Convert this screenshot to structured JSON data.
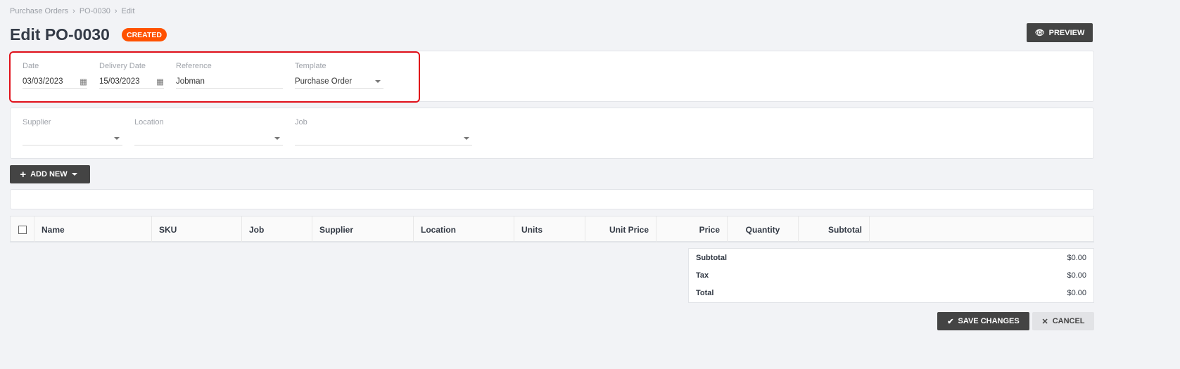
{
  "breadcrumb": [
    "Purchase Orders",
    "PO-0030",
    "Edit"
  ],
  "title": "Edit PO-0030",
  "status": "CREATED",
  "preview_label": "PREVIEW",
  "header_fields": {
    "date_label": "Date",
    "date": "03/03/2023",
    "delivery_label": "Delivery Date",
    "delivery": "15/03/2023",
    "reference_label": "Reference",
    "reference": "Jobman",
    "template_label": "Template",
    "template": "Purchase Order"
  },
  "assign_fields": {
    "supplier_label": "Supplier",
    "location_label": "Location",
    "job_label": "Job"
  },
  "add_new_label": "ADD NEW",
  "columns": [
    "Name",
    "SKU",
    "Job",
    "Supplier",
    "Location",
    "Units",
    "Unit Price",
    "Price",
    "Quantity",
    "Subtotal"
  ],
  "totals": [
    {
      "label": "Subtotal",
      "value": "$0.00"
    },
    {
      "label": "Tax",
      "value": "$0.00"
    },
    {
      "label": "Total",
      "value": "$0.00"
    }
  ],
  "save_label": "SAVE CHANGES",
  "cancel_label": "CANCEL"
}
